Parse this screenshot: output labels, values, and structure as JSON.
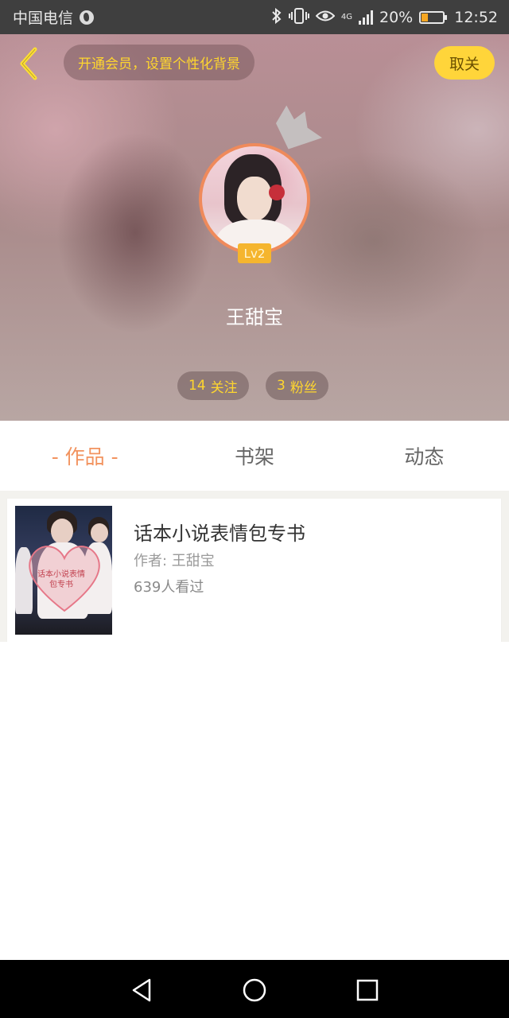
{
  "status_bar": {
    "carrier": "中国电信",
    "battery_percent": "20%",
    "time": "12:52",
    "network_label": "4G",
    "icons": [
      "globe-icon",
      "bluetooth-icon",
      "vibrate-icon",
      "eye-icon",
      "signal-icon",
      "battery-icon"
    ]
  },
  "header": {
    "vip_banner": "开通会员，设置个性化背景",
    "follow_button": "取关",
    "level": "Lv2",
    "username": "王甜宝",
    "following_count": "14",
    "following_label": "关注",
    "fans_count": "3",
    "fans_label": "粉丝",
    "accent_color": "#ffd62e",
    "avatar_border_color": "#ef8a5b"
  },
  "tabs": [
    {
      "label": "- 作品 -",
      "active": true
    },
    {
      "label": "书架",
      "active": false
    },
    {
      "label": "动态",
      "active": false
    }
  ],
  "books": [
    {
      "title": "话本小说表情包专书",
      "author": "作者: 王甜宝",
      "views": "639人看过",
      "cover_text": "话本小说表情包专书"
    }
  ],
  "nav_bar": {
    "buttons": [
      "back-triangle-icon",
      "home-circle-icon",
      "recents-square-icon"
    ]
  }
}
